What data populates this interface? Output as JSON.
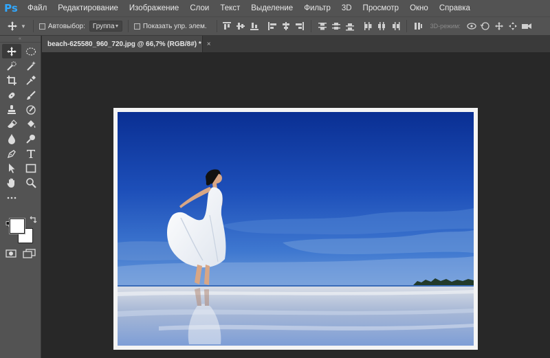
{
  "app": {
    "logo": "Ps",
    "menu": [
      "Файл",
      "Редактирование",
      "Изображение",
      "Слои",
      "Текст",
      "Выделение",
      "Фильтр",
      "3D",
      "Просмотр",
      "Окно",
      "Справка"
    ]
  },
  "options_bar": {
    "autoselect_label": "Автовыбор:",
    "autoselect_checked": false,
    "autoselect_target": "Группа",
    "show_transform_label": "Показать упр. элем.",
    "show_transform_checked": false,
    "mode_3d_label": "3D-режим:"
  },
  "document": {
    "tab_title": "beach-625580_960_720.jpg @ 66,7% (RGB/8#) *",
    "close_glyph": "×"
  },
  "colors": {
    "chrome": "#535353",
    "workspace": "#282828",
    "ps_blue": "#31a8ff",
    "foreground_swatch": "#ffffff",
    "background_swatch": "#ffffff"
  },
  "toolbar": {
    "collapse_glyph": "«",
    "tools": [
      "move-tool",
      "ellipse-marquee-tool",
      "quick-selection-tool",
      "magic-wand-tool",
      "crop-tool",
      "eyedropper-tool",
      "spot-healing-tool",
      "brush-tool",
      "clone-stamp-tool",
      "history-brush-tool",
      "eraser-tool",
      "paint-bucket-tool",
      "blur-tool",
      "dodge-tool",
      "pen-tool",
      "type-tool",
      "path-selection-tool",
      "rectangle-tool",
      "hand-tool",
      "zoom-tool",
      "more-tools",
      "color-swatches",
      "quick-mask",
      "screen-mode"
    ]
  }
}
